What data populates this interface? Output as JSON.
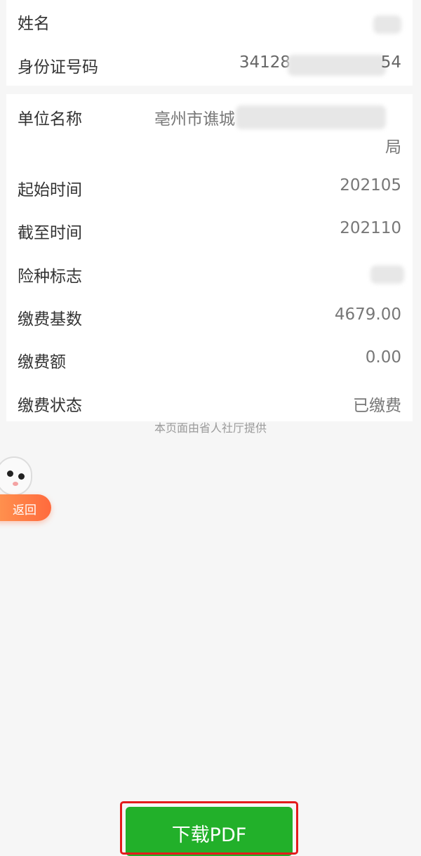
{
  "identity": {
    "name_label": "姓名",
    "id_label": "身份证号码",
    "id_value_start": "34128",
    "id_value_end": "54"
  },
  "record": {
    "unit_label": "单位名称",
    "unit_value_start": "亳州市谯城",
    "unit_value_end": "局",
    "start_label": "起始时间",
    "start_value": "202105",
    "end_label": "截至时间",
    "end_value": "202110",
    "insurance_label": "险种标志",
    "base_label": "缴费基数",
    "base_value": "4679.00",
    "amount_label": "缴费额",
    "amount_value": "0.00",
    "status_label": "缴费状态",
    "status_value": "已缴费"
  },
  "footer_note": "本页面由省人社厅提供",
  "back_button_label": "返回",
  "download_button_label": "下载PDF",
  "colors": {
    "download_green": "#22b02a",
    "highlight_red": "#e31c1c",
    "back_orange": "#ff7a45"
  }
}
